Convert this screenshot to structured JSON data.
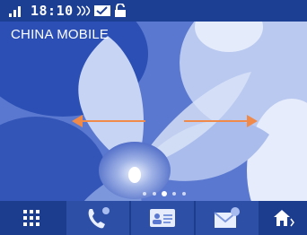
{
  "status_bar": {
    "time": "18:10",
    "icons": [
      "signal-icon",
      "sync-icon",
      "message-icon",
      "lock-icon"
    ]
  },
  "home": {
    "carrier": "CHINA MOBILE",
    "swipe_hint": [
      "arrow-left-icon",
      "arrow-right-icon"
    ],
    "page_indicator": {
      "pages": 5,
      "current": 3
    }
  },
  "dock": {
    "items": [
      "apps-icon",
      "phone-icon",
      "contacts-icon",
      "messages-icon",
      "home-icon"
    ]
  },
  "colors": {
    "accent_arrow": "#f08a4b",
    "wallpaper_tint": "#3c5fc0",
    "dock": "#1c3c8e"
  }
}
